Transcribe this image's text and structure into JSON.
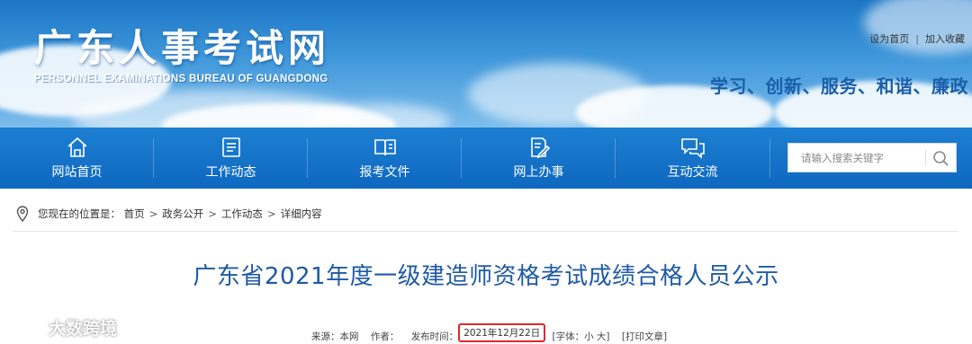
{
  "header": {
    "site_title": "广东人事考试网",
    "site_subtitle": "PERSONNEL EXAMINATIONS BUREAU OF GUANGDONG",
    "links": [
      "设为首页",
      "加入收藏"
    ],
    "link_separator": "|",
    "slogan": "学习、创新、服务、和谐、廉政"
  },
  "nav": {
    "items": [
      {
        "label": "网站首页",
        "icon": "home-icon"
      },
      {
        "label": "工作动态",
        "icon": "news-list-icon"
      },
      {
        "label": "报考文件",
        "icon": "book-icon"
      },
      {
        "label": "网上办事",
        "icon": "edit-document-icon"
      },
      {
        "label": "互动交流",
        "icon": "chat-icon"
      }
    ]
  },
  "search": {
    "placeholder": "请输入搜索关键字",
    "icon": "search-icon"
  },
  "breadcrumb": {
    "prefix": "您现在的位置是：",
    "items": [
      "首页",
      "政务公开",
      "工作动态",
      "详细内容"
    ],
    "separator": ">"
  },
  "article": {
    "title": "广东省2021年度一级建造师资格考试成绩合格人员公示",
    "meta": {
      "source": "来源：本网",
      "author": "作者：",
      "publish_label": "发布时间：",
      "publish_date": "2021年12月22日",
      "font_size": "[字体：小 大]",
      "print": "[打印文章]"
    }
  },
  "watermark": {
    "text": "大数跨境"
  },
  "colors": {
    "nav_bg": "#0e68bf",
    "title_blue": "#1f5aa6",
    "slogan_blue": "#1a5faa",
    "highlight_red": "#e0282a"
  }
}
